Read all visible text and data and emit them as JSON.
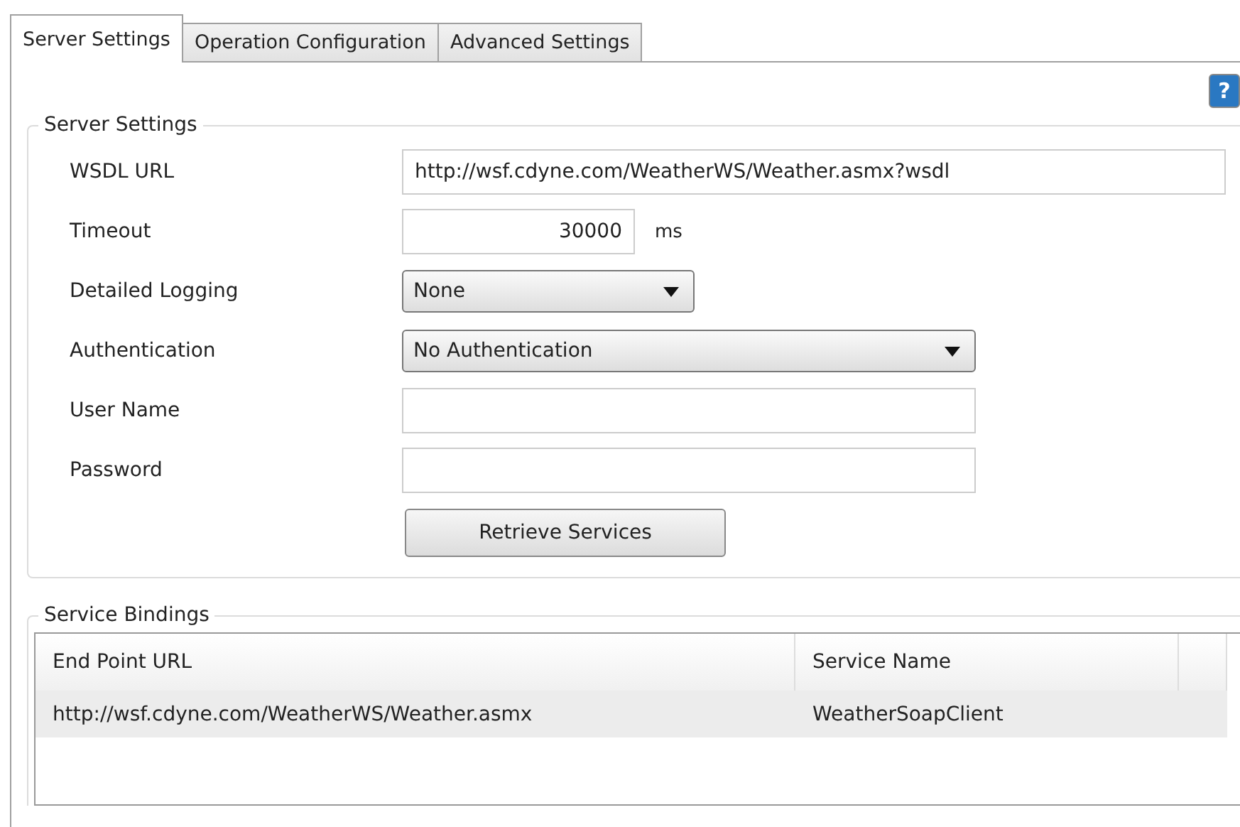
{
  "tabs": [
    {
      "label": "Server Settings",
      "selected": true
    },
    {
      "label": "Operation Configuration",
      "selected": false
    },
    {
      "label": "Advanced Settings",
      "selected": false
    }
  ],
  "help_button": {
    "label": "?"
  },
  "server_settings": {
    "title": "Server Settings",
    "fields": [
      {
        "kind": "text",
        "label": "WSDL URL",
        "value": "http://wsf.cdyne.com/WeatherWS/Weather.asmx?wsdl"
      },
      {
        "kind": "number",
        "label": "Timeout",
        "value": "30000",
        "unit": "ms"
      },
      {
        "kind": "dropdown",
        "label": "Detailed Logging",
        "value": "None"
      },
      {
        "kind": "dropdown",
        "label": "Authentication",
        "value": "No Authentication"
      },
      {
        "kind": "text",
        "label": "User Name"
      },
      {
        "kind": "text",
        "label": "Password"
      }
    ],
    "button": "Retrieve Services"
  },
  "service_bindings": {
    "title": "Service Bindings",
    "columns": [
      "End Point URL",
      "Service Name"
    ],
    "rows": [
      {
        "cells": [
          "http://wsf.cdyne.com/WeatherWS/Weather.asmx",
          "WeatherSoapClient"
        ],
        "selected": true
      }
    ]
  }
}
